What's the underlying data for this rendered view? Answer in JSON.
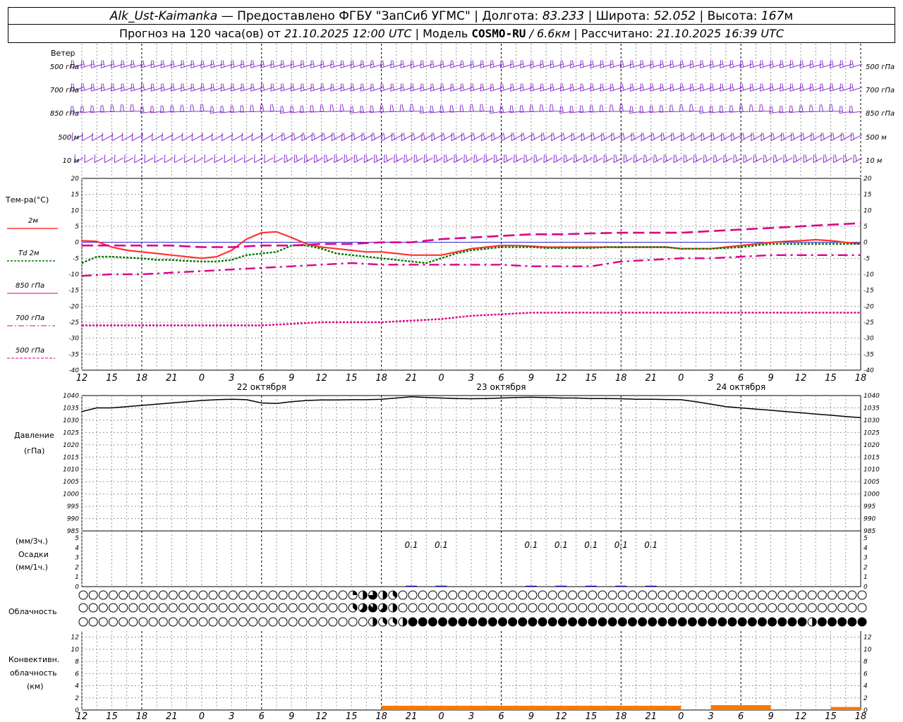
{
  "header": {
    "station": "Alk_Ust-Kaimanka",
    "provider": "— Предоставлено ФГБУ \"ЗапСиб УГМС\" |",
    "lon_label": "Долгота:",
    "lon": "83.233",
    "lat_label": "| Широта:",
    "lat": "52.052",
    "alt_label": "| Высота:",
    "alt": "167",
    "alt_unit": "м",
    "forecast_label": "Прогноз на 120 часа(ов) от",
    "forecast_start": "21.10.2025 12:00 UTC",
    "model_label": "| Модель",
    "model": "COSMO-RU",
    "resolution": "/ 6.6км",
    "calc_label": "| Рассчитано:",
    "calc_time": "21.10.2025 16:39 UTC"
  },
  "wind_panel": {
    "title": "Ветер",
    "levels": [
      "500 гПа",
      "700 гПа",
      "850 гПа",
      "500 м",
      "10 м"
    ]
  },
  "temp_panel": {
    "title": "Тем-ра(°С)",
    "legend": [
      {
        "label": "2м",
        "color": "#ff3333",
        "style": "solid"
      },
      {
        "label": "Td 2м",
        "color": "#007700",
        "style": "dotted"
      },
      {
        "label": "850 гПа",
        "color": "#dd0088",
        "style": "solid-thin"
      },
      {
        "label": "700 гПа",
        "color": "#dd0088",
        "style": "dashdot"
      },
      {
        "label": "500 гПа",
        "color": "#dd0088",
        "style": "dashed-thin"
      }
    ]
  },
  "pressure_panel": {
    "title": "Давление",
    "unit": "(гПа)"
  },
  "precip_panel": {
    "unit_3h": "(мм/3ч.)",
    "title": "Осадки",
    "unit_1h": "(мм/1ч.)",
    "labels": [
      {
        "hour": 66,
        "text": "0.1"
      },
      {
        "hour": 72,
        "text": "0.1"
      },
      {
        "hour": 90,
        "text": "0.1"
      },
      {
        "hour": 96,
        "text": "0.1"
      },
      {
        "hour": 102,
        "text": "0.1"
      },
      {
        "hour": 108,
        "text": "0.1"
      },
      {
        "hour": 114,
        "text": "0.1"
      }
    ]
  },
  "cloud_panel": {
    "title": "Облачность"
  },
  "conv_panel": {
    "title_1": "Конвективн.",
    "title_2": "облачность",
    "unit": "(км)"
  },
  "x_axis": {
    "tick_labels": [
      "12",
      "15",
      "18",
      "21",
      "0",
      "3",
      "6",
      "9",
      "12",
      "15",
      "18",
      "21",
      "0",
      "3",
      "6",
      "9",
      "12",
      "15",
      "18",
      "21",
      "0",
      "3",
      "6",
      "9",
      "12",
      "15",
      "18"
    ],
    "dates": [
      {
        "hour": 36,
        "text": "22 октября"
      },
      {
        "hour": 84,
        "text": "23 октября"
      },
      {
        "hour": 132,
        "text": "24 октября"
      }
    ]
  },
  "chart_data": {
    "type": "line",
    "title": "Alk_Ust-Kaimanka",
    "x_unit": "hours from 21.10.2025 12:00 UTC",
    "xlim": [
      0,
      156
    ],
    "temperature": {
      "ylabel": "Тем-ра(°С)",
      "ylim": [
        -40,
        20
      ],
      "yticks": [
        20,
        15,
        10,
        5,
        0,
        -5,
        -10,
        -15,
        -20,
        -25,
        -30,
        -35,
        -40
      ],
      "series": [
        {
          "name": "2м",
          "x": [
            0,
            3,
            6,
            9,
            12,
            15,
            18,
            21,
            24,
            27,
            30,
            33,
            36,
            39,
            42,
            45,
            48,
            51,
            54,
            57,
            60,
            63,
            66,
            69,
            72,
            75,
            78,
            81,
            84,
            87,
            90,
            93,
            96,
            99,
            102,
            105,
            108,
            111,
            114,
            117,
            120,
            123,
            126,
            129,
            132,
            135,
            138,
            141,
            144,
            147,
            150,
            153,
            156
          ],
          "values": [
            0.5,
            0.3,
            -1.5,
            -2.5,
            -3,
            -3.5,
            -4,
            -4.5,
            -5,
            -4.5,
            -2.5,
            1,
            3,
            3.3,
            1.5,
            -0.5,
            -1.5,
            -2,
            -2.5,
            -3,
            -3,
            -3.5,
            -4,
            -4,
            -4,
            -3,
            -2,
            -1.5,
            -1,
            -1,
            -1.2,
            -1.5,
            -1.5,
            -1.5,
            -1.5,
            -1.5,
            -1.5,
            -1.5,
            -1.5,
            -1.5,
            -2,
            -2,
            -2,
            -1.5,
            -1,
            -0.5,
            0,
            0.3,
            0.5,
            0.8,
            0.5,
            0,
            -0.5
          ]
        },
        {
          "name": "Td 2м",
          "x": [
            0,
            3,
            6,
            9,
            12,
            15,
            18,
            21,
            24,
            27,
            30,
            33,
            36,
            39,
            42,
            45,
            48,
            51,
            54,
            57,
            60,
            63,
            66,
            69,
            72,
            75,
            78,
            81,
            84,
            87,
            90,
            93,
            96,
            99,
            102,
            105,
            108,
            111,
            114,
            117,
            120,
            123,
            126,
            129,
            132,
            135,
            138,
            141,
            144,
            147,
            150,
            153,
            156
          ],
          "values": [
            -6.5,
            -4.5,
            -4.5,
            -4.8,
            -5,
            -5.5,
            -5.5,
            -5.8,
            -6,
            -6,
            -5.5,
            -4,
            -3.5,
            -3,
            -1,
            -1,
            -2,
            -3.5,
            -4,
            -4.5,
            -5,
            -5.5,
            -6,
            -6.5,
            -5,
            -3.5,
            -2.5,
            -2,
            -1.5,
            -1.5,
            -1.5,
            -1.8,
            -1.8,
            -1.8,
            -1.8,
            -1.5,
            -1.5,
            -1.5,
            -1.5,
            -1.5,
            -2,
            -2,
            -2,
            -1.8,
            -1.5,
            -1,
            -0.5,
            -0.5,
            -0.5,
            -0.5,
            -0.5,
            -0.5,
            -0.5
          ]
        },
        {
          "name": "850 гПа",
          "x": [
            0,
            6,
            12,
            18,
            24,
            30,
            36,
            42,
            48,
            54,
            60,
            66,
            72,
            78,
            84,
            90,
            96,
            102,
            108,
            114,
            120,
            126,
            132,
            138,
            144,
            150,
            156
          ],
          "values": [
            -1,
            -1,
            -1,
            -1,
            -1.5,
            -1.5,
            -1,
            -1,
            -0.5,
            -0.5,
            0,
            0,
            1,
            1.5,
            2,
            2.5,
            2.5,
            2.8,
            3,
            3,
            3,
            3.5,
            4,
            4.5,
            5,
            5.5,
            6
          ]
        },
        {
          "name": "700 гПа",
          "x": [
            0,
            6,
            12,
            18,
            24,
            30,
            36,
            42,
            48,
            54,
            60,
            66,
            72,
            78,
            84,
            90,
            96,
            102,
            108,
            114,
            120,
            126,
            132,
            138,
            144,
            150,
            156
          ],
          "values": [
            -10.5,
            -10,
            -10,
            -9.5,
            -9,
            -8.5,
            -8,
            -7.5,
            -7,
            -6.5,
            -7,
            -7,
            -7,
            -7,
            -7,
            -7.5,
            -7.5,
            -7.5,
            -6,
            -5.5,
            -5,
            -5,
            -4.5,
            -4,
            -4,
            -4,
            -4
          ]
        },
        {
          "name": "500 гПа",
          "x": [
            0,
            6,
            12,
            18,
            24,
            30,
            36,
            42,
            48,
            54,
            60,
            66,
            72,
            78,
            84,
            90,
            96,
            102,
            108,
            114,
            120,
            126,
            132,
            138,
            144,
            150,
            156
          ],
          "values": [
            -26,
            -26,
            -26,
            -26,
            -26,
            -26,
            -26,
            -25.5,
            -25,
            -25,
            -25,
            -24.5,
            -24,
            -23,
            -22.5,
            -22,
            -22,
            -22,
            -22,
            -22,
            -22,
            -22,
            -22,
            -22,
            -22,
            -22,
            -22
          ]
        }
      ]
    },
    "pressure": {
      "ylabel": "Давление",
      "ylim": [
        985,
        1040
      ],
      "yticks": [
        1040,
        1035,
        1030,
        1025,
        1020,
        1015,
        1010,
        1005,
        1000,
        995,
        990,
        985
      ],
      "series": [
        {
          "name": "Давление",
          "x": [
            0,
            3,
            6,
            9,
            12,
            15,
            18,
            21,
            24,
            27,
            30,
            33,
            36,
            39,
            42,
            45,
            48,
            51,
            54,
            57,
            60,
            63,
            66,
            69,
            72,
            75,
            78,
            81,
            84,
            87,
            90,
            93,
            96,
            99,
            102,
            105,
            108,
            111,
            114,
            117,
            120,
            123,
            126,
            129,
            132,
            135,
            138,
            141,
            144,
            147,
            150,
            153,
            156
          ],
          "values": [
            1033.5,
            1035,
            1035,
            1035.5,
            1036,
            1036.5,
            1037,
            1037.5,
            1038,
            1038.3,
            1038.5,
            1038.3,
            1037,
            1036.8,
            1037.5,
            1038,
            1038.2,
            1038.2,
            1038.3,
            1038.3,
            1038.5,
            1039,
            1039.5,
            1039.2,
            1039,
            1038.8,
            1038.7,
            1038.8,
            1039,
            1039.2,
            1039.3,
            1039.2,
            1039,
            1039,
            1038.8,
            1038.8,
            1038.7,
            1038.5,
            1038.5,
            1038.4,
            1038.3,
            1037.5,
            1036.5,
            1035.5,
            1035,
            1034.5,
            1034,
            1033.5,
            1033,
            1032.5,
            1032,
            1031.5,
            1031
          ]
        }
      ]
    },
    "precipitation": {
      "ylim": [
        0,
        5
      ],
      "yticks": [
        5,
        4,
        3,
        2,
        1,
        0
      ],
      "bars_mm_3h": [
        {
          "hour": 66,
          "value": 0.1
        },
        {
          "hour": 72,
          "value": 0.1
        },
        {
          "hour": 90,
          "value": 0.1
        },
        {
          "hour": 96,
          "value": 0.1
        },
        {
          "hour": 102,
          "value": 0.1
        },
        {
          "hour": 108,
          "value": 0.1
        },
        {
          "hour": 114,
          "value": 0.1
        }
      ]
    },
    "cloudiness": {
      "rows": 3,
      "points_per_row": 79,
      "step_hours": 2,
      "cover_eighths_row1": [
        [
          54,
          2
        ],
        [
          56,
          4
        ],
        [
          58,
          6
        ],
        [
          60,
          4
        ],
        [
          62,
          3
        ]
      ],
      "cover_eighths_row2": [
        [
          54,
          3
        ],
        [
          56,
          5
        ],
        [
          58,
          7
        ],
        [
          60,
          5
        ],
        [
          62,
          4
        ]
      ],
      "cover_eighths_row3_overcast_from": 66,
      "cover_eighths_row3_partial": [
        [
          58,
          4
        ],
        [
          60,
          3
        ],
        [
          62,
          3
        ],
        [
          64,
          4
        ],
        [
          146,
          4
        ]
      ]
    },
    "convective_cloud": {
      "ylabel": "(км)",
      "ylim": [
        0,
        13
      ],
      "yticks": [
        12,
        10,
        8,
        6,
        4,
        2,
        0
      ],
      "segments": [
        {
          "from": 60,
          "to": 120,
          "value": 0.7
        },
        {
          "from": 126,
          "to": 138,
          "value": 0.8
        },
        {
          "from": 150,
          "to": 156,
          "value": 0.5
        }
      ]
    },
    "wind_barbs_levels": [
      "500 гПа",
      "700 гПа",
      "850 гПа",
      "500 м",
      "10 м"
    ]
  }
}
